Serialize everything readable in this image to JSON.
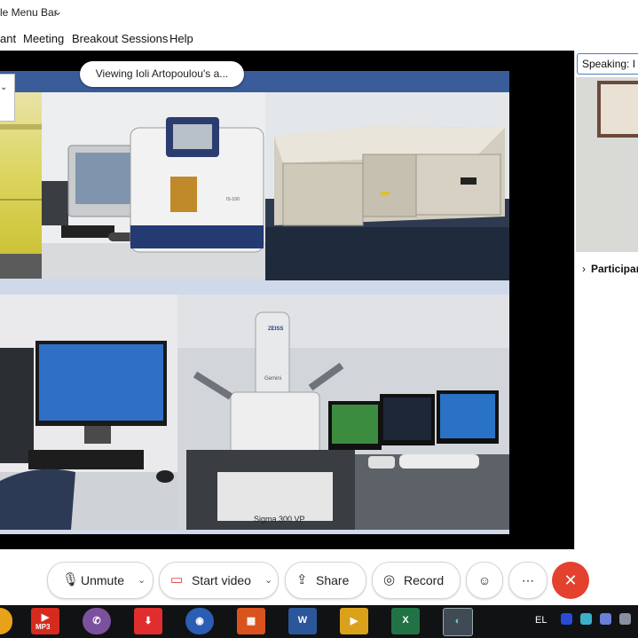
{
  "window": {
    "title": "le Menu Bar"
  },
  "menu": {
    "items": [
      "ant",
      "Meeting",
      "Breakout Sessions",
      "Help"
    ]
  },
  "share": {
    "viewing_label": "Viewing Ioli Artopoulou's a..."
  },
  "photos": {
    "instrument_2_label": "IS-100",
    "sem_column_label": "Gemini",
    "sem_base_label": "Sigma 300 VP",
    "sem_brand": "ZEISS"
  },
  "right_panel": {
    "speaking_label": "Speaking: I",
    "participants_label": "Participants"
  },
  "controls": {
    "unmute_label": "Unmute",
    "start_video_label": "Start video",
    "share_label": "Share",
    "record_label": "Record"
  },
  "taskbar": {
    "mp3_badge": "MP3",
    "language": "EL"
  },
  "colors": {
    "end_button": "#e4412f",
    "accent": "#4a7fc1",
    "stage": "#000000",
    "taskbar": "#101214"
  },
  "icons": [
    "chevron-down-icon",
    "microphone-muted-icon",
    "video-off-icon",
    "share-icon",
    "record-icon",
    "reactions-icon",
    "more-icon",
    "close-icon",
    "chevron-right-icon"
  ]
}
